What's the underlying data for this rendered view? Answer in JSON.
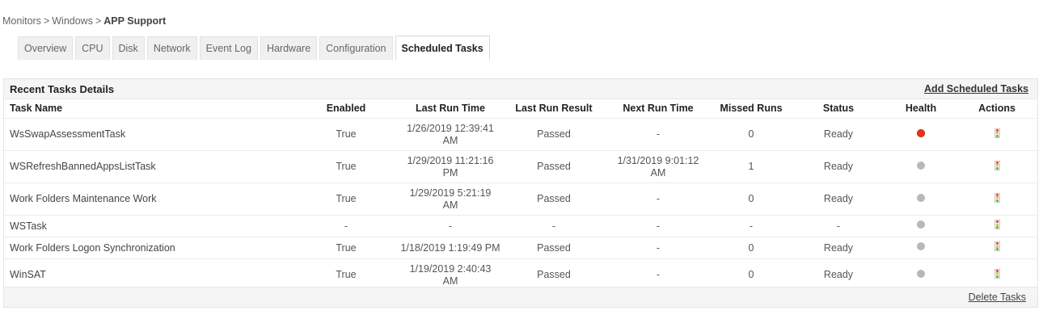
{
  "breadcrumb": {
    "items": [
      "Monitors",
      "Windows"
    ],
    "separator": ">",
    "current": "APP Support"
  },
  "tabs": [
    {
      "label": "Overview",
      "active": false
    },
    {
      "label": "CPU",
      "active": false
    },
    {
      "label": "Disk",
      "active": false
    },
    {
      "label": "Network",
      "active": false
    },
    {
      "label": "Event Log",
      "active": false
    },
    {
      "label": "Hardware",
      "active": false
    },
    {
      "label": "Configuration",
      "active": false
    },
    {
      "label": "Scheduled Tasks",
      "active": true
    }
  ],
  "panel": {
    "title": "Recent Tasks Details",
    "add_link": "Add Scheduled Tasks",
    "delete_link": "Delete Tasks"
  },
  "table": {
    "headers": [
      "Task Name",
      "Enabled",
      "Last Run Time",
      "Last Run Result",
      "Next Run Time",
      "Missed Runs",
      "Status",
      "Health",
      "Actions"
    ],
    "rows": [
      {
        "name": "WsSwapAssessmentTask",
        "enabled": "True",
        "last_run_line1": "1/26/2019 12:39:41",
        "last_run_line2": "AM",
        "result": "Passed",
        "next_run_line1": "-",
        "next_run_line2": "",
        "missed": "0",
        "status": "Ready",
        "health": "red",
        "action_icon": "traffic-light-icon"
      },
      {
        "name": "WSRefreshBannedAppsListTask",
        "enabled": "True",
        "last_run_line1": "1/29/2019 11:21:16",
        "last_run_line2": "PM",
        "result": "Passed",
        "next_run_line1": "1/31/2019 9:01:12",
        "next_run_line2": "AM",
        "missed": "1",
        "status": "Ready",
        "health": "grey",
        "action_icon": "traffic-light-icon"
      },
      {
        "name": "Work Folders Maintenance Work",
        "enabled": "True",
        "last_run_line1": "1/29/2019 5:21:19",
        "last_run_line2": "AM",
        "result": "Passed",
        "next_run_line1": "-",
        "next_run_line2": "",
        "missed": "0",
        "status": "Ready",
        "health": "grey",
        "action_icon": "traffic-light-icon"
      },
      {
        "name": "WSTask",
        "enabled": "-",
        "last_run_line1": "-",
        "last_run_line2": "",
        "result": "-",
        "next_run_line1": "-",
        "next_run_line2": "",
        "missed": "-",
        "status": "-",
        "health": "grey",
        "action_icon": "traffic-light-icon"
      },
      {
        "name": "Work Folders Logon Synchronization",
        "enabled": "True",
        "last_run_line1": "1/18/2019 1:19:49 PM",
        "last_run_line2": "",
        "result": "Passed",
        "next_run_line1": "-",
        "next_run_line2": "",
        "missed": "0",
        "status": "Ready",
        "health": "grey",
        "action_icon": "traffic-light-icon"
      },
      {
        "name": "WinSAT",
        "enabled": "True",
        "last_run_line1": "1/19/2019 2:40:43",
        "last_run_line2": "AM",
        "result": "Passed",
        "next_run_line1": "-",
        "next_run_line2": "",
        "missed": "0",
        "status": "Ready",
        "health": "grey",
        "action_icon": "traffic-light-icon"
      }
    ]
  },
  "colors": {
    "health_red": "#e8321a",
    "health_grey": "#b8b8b8",
    "header_bg": "#f5f5f5"
  }
}
